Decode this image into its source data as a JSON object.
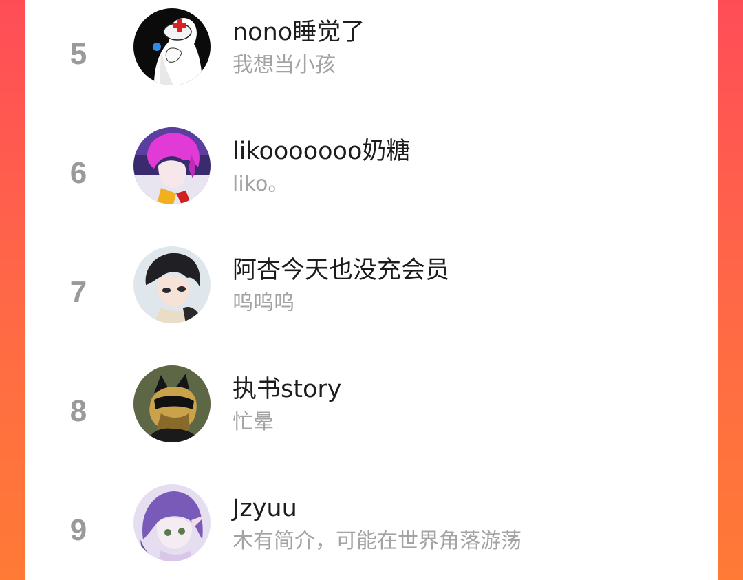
{
  "users": [
    {
      "rank": "5",
      "name": "nono睡觉了",
      "bio": "我想当小孩",
      "avatar": "avatar-nurse-icon"
    },
    {
      "rank": "6",
      "name": "likooooooo奶糖",
      "bio": "liko。",
      "avatar": "avatar-pink-hair-icon"
    },
    {
      "rank": "7",
      "name": "阿杏今天也没充会员",
      "bio": "呜呜呜",
      "avatar": "avatar-dark-hair-icon"
    },
    {
      "rank": "8",
      "name": "执书story",
      "bio": "忙晕",
      "avatar": "avatar-masked-cat-icon"
    },
    {
      "rank": "9",
      "name": "Jzyuu",
      "bio": "木有简介，可能在世界角落游荡",
      "avatar": "avatar-purple-hair-icon"
    }
  ],
  "colors": {
    "panel": "#ffffff",
    "rank": "#9a9a9a",
    "name": "#1c1c1c",
    "bio": "#a3a3a3",
    "side_gradient_top": "#ff4d57",
    "side_gradient_bottom": "#ff7a35"
  }
}
